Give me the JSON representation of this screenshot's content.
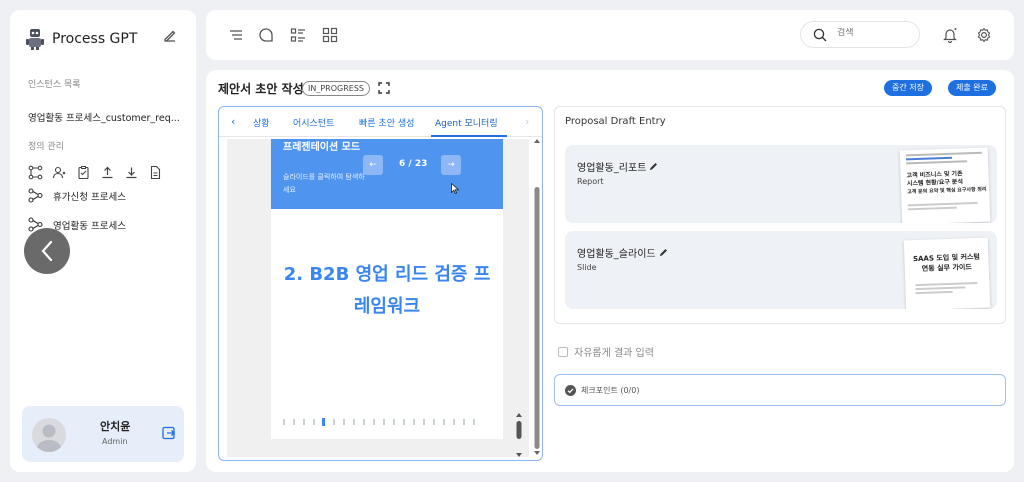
{
  "sidebar": {
    "app_name": "Process GPT",
    "instances_label": "인스턴스 목록",
    "instance_item": "영업활동 프로세스_customer_req...",
    "definitions_label": "정의 관리",
    "processes": [
      {
        "label": "휴가신청 프로세스"
      },
      {
        "label": "영업활동 프로세스"
      }
    ],
    "user": {
      "name": "안치윤",
      "role": "Admin"
    }
  },
  "topbar": {
    "search_placeholder": "검색"
  },
  "main": {
    "title": "제안서 초안 작성",
    "status": "IN_PROGRESS",
    "save_draft_label": "중간 저장",
    "submit_label": "제출 완료",
    "tabs": [
      {
        "label": "상황"
      },
      {
        "label": "어시스턴트"
      },
      {
        "label": "빠른 초안 생성"
      },
      {
        "label": "Agent 모니터링"
      }
    ],
    "preview": {
      "header_title": "프레젠테이션 모드",
      "header_hint": "슬라이드를 클릭하여 탐색하세요",
      "counter": "6 / 23",
      "prev": "←",
      "next": "→",
      "slide_title": "2. B2B 영업 리드 검증 프레임워크"
    },
    "proposal": {
      "title": "Proposal Draft Entry",
      "docs": [
        {
          "name": "영업활동_리포트",
          "type": "Report",
          "thumb_lines": [
            "고객 비즈니스 및 기존",
            "시스템 현황/요구 분석",
            "고객 문의 요약 및 핵심 요구사항 정리"
          ]
        },
        {
          "name": "영업활동_슬라이드",
          "type": "Slide",
          "thumb_lines": [
            "SAAS 도입 및 커스텀",
            "연동 실무 가이드"
          ]
        }
      ]
    },
    "free_input_label": "자유롭게 결과 입력",
    "checkpoint_label": "체크포인트 (0/0)"
  },
  "colors": {
    "accent": "#1e6fe0",
    "slide_blue": "#4f94ef",
    "slide_title": "#3a86ee"
  }
}
